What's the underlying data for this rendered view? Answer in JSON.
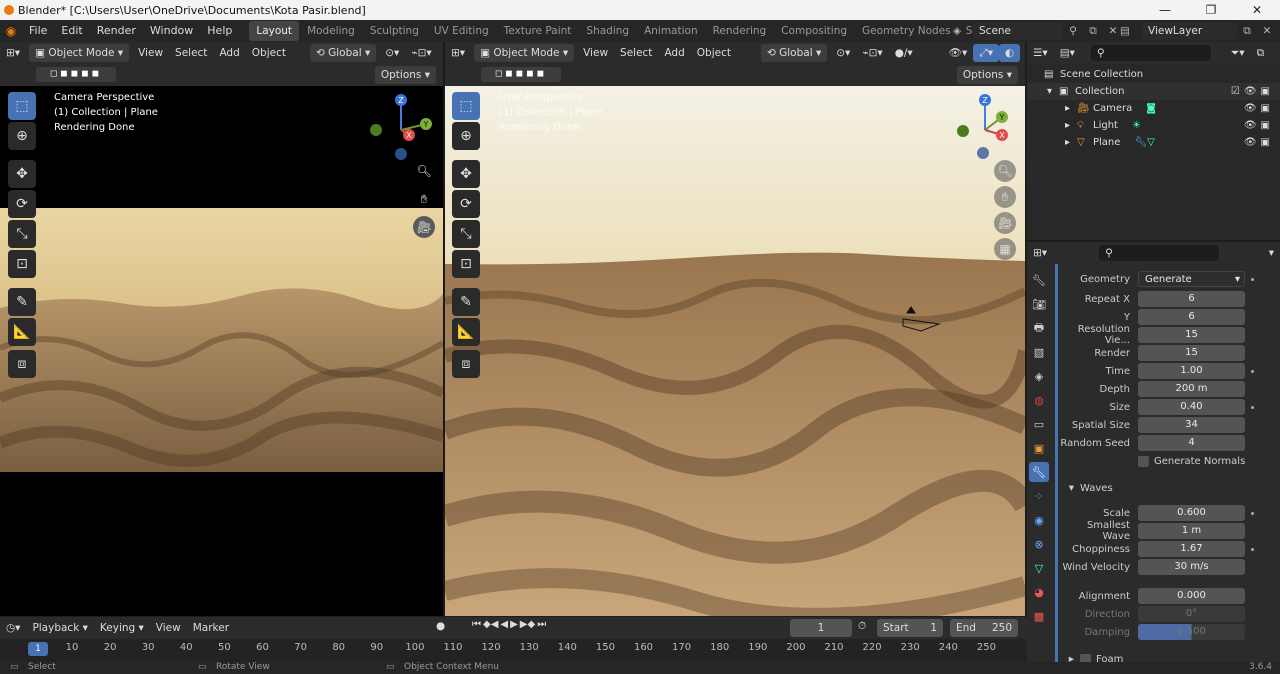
{
  "window": {
    "title": "Blender* [C:\\Users\\User\\OneDrive\\Documents\\Kota Pasir.blend]",
    "min": "—",
    "max": "❐",
    "close": "✕"
  },
  "menu": [
    "File",
    "Edit",
    "Render",
    "Window",
    "Help"
  ],
  "workspaces": [
    "Layout",
    "Modeling",
    "Sculpting",
    "UV Editing",
    "Texture Paint",
    "Shading",
    "Animation",
    "Rendering",
    "Compositing",
    "Geometry Nodes",
    "Scripting"
  ],
  "add_workspace": "+",
  "scene": "Scene",
  "viewlayer": "ViewLayer",
  "vp_left": {
    "mode": "Object Mode",
    "menus": [
      "View",
      "Select",
      "Add",
      "Object"
    ],
    "orientation": "Global",
    "options": "Options",
    "overlay": [
      "Camera Perspective",
      "(1) Collection | Plane",
      "Rendering Done"
    ]
  },
  "vp_right": {
    "mode": "Object Mode",
    "menus": [
      "View",
      "Select",
      "Add",
      "Object"
    ],
    "orientation": "Global",
    "options": "Options",
    "overlay": [
      "User Perspective",
      "(1) Collection | Plane",
      "Rendering Done"
    ]
  },
  "gizmo": {
    "x": "X",
    "y": "Y",
    "z": "Z"
  },
  "outliner": {
    "root": "Scene Collection",
    "collection": "Collection",
    "items": [
      "Camera",
      "Light",
      "Plane"
    ]
  },
  "props": {
    "geometry": {
      "label": "Geometry",
      "value": "Generate"
    },
    "rows": [
      [
        "Repeat X",
        "6"
      ],
      [
        "Y",
        "6"
      ],
      [
        "Resolution Vie...",
        "15"
      ],
      [
        "Render",
        "15"
      ],
      [
        "Time",
        "1.00"
      ],
      [
        "Depth",
        "200 m"
      ],
      [
        "Size",
        "0.40"
      ],
      [
        "Spatial Size",
        "34"
      ],
      [
        "Random Seed",
        "4"
      ]
    ],
    "generate_normals": "Generate Normals",
    "waves_header": "Waves",
    "waves": [
      [
        "Scale",
        "0.600"
      ],
      [
        "Smallest Wave",
        "1 m"
      ],
      [
        "Choppiness",
        "1.67"
      ],
      [
        "Wind Velocity",
        "30 m/s"
      ]
    ],
    "align": [
      [
        "Alignment",
        "0.000"
      ],
      [
        "Direction",
        "0°"
      ],
      [
        "Damping",
        "0.500"
      ]
    ],
    "foam": "Foam"
  },
  "timeline": {
    "menus": [
      "Playback",
      "Keying",
      "View",
      "Marker"
    ],
    "current": "1",
    "start_label": "Start",
    "start": "1",
    "end_label": "End",
    "end": "250",
    "ticks": [
      "10",
      "20",
      "30",
      "40",
      "50",
      "60",
      "70",
      "80",
      "90",
      "100",
      "110",
      "120",
      "130",
      "140",
      "150",
      "160",
      "170",
      "180",
      "190",
      "200",
      "210",
      "220",
      "230",
      "240",
      "250"
    ],
    "frame_badge": "1"
  },
  "status": {
    "select": "Select",
    "rotate": "Rotate View",
    "context": "Object Context Menu",
    "version": "3.6.4"
  }
}
